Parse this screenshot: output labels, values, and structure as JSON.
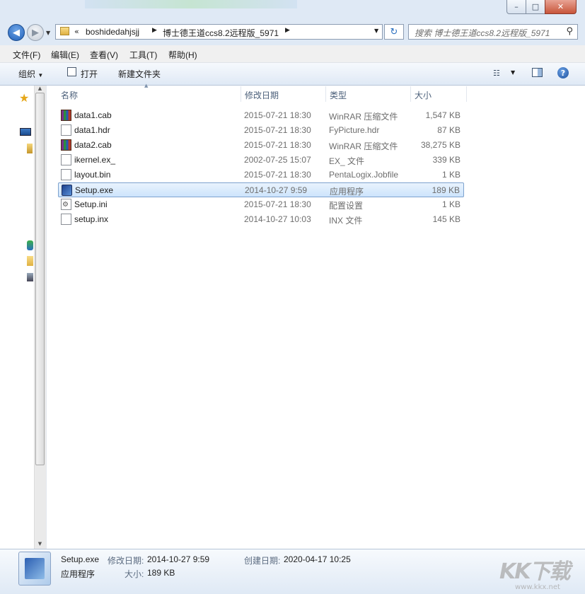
{
  "window": {
    "minimize_glyph": "–",
    "maximize_glyph": "□",
    "close_glyph": "✕"
  },
  "nav": {
    "back_glyph": "◀",
    "forward_glyph": "▶",
    "overflow": "«",
    "breadcrumbs": [
      "boshidedahjsjj",
      "博士德王道ccs8.2远程版_5971"
    ],
    "refresh_glyph": "↻"
  },
  "search": {
    "placeholder": "搜索 博士德王道ccs8.2远程版_5971"
  },
  "menu": {
    "items": [
      "文件(F)",
      "编辑(E)",
      "查看(V)",
      "工具(T)",
      "帮助(H)"
    ]
  },
  "toolbar": {
    "organize_label": "组织",
    "open_label": "打开",
    "new_folder_label": "新建文件夹",
    "help_glyph": "?"
  },
  "columns": {
    "name": "名称",
    "date": "修改日期",
    "type": "类型",
    "size": "大小"
  },
  "files": [
    {
      "name": "data1.cab",
      "date": "2015-07-21 18:30",
      "type": "WinRAR 压缩文件",
      "size": "1,547 KB",
      "icon": "rar"
    },
    {
      "name": "data1.hdr",
      "date": "2015-07-21 18:30",
      "type": "FyPicture.hdr",
      "size": "87 KB",
      "icon": "file"
    },
    {
      "name": "data2.cab",
      "date": "2015-07-21 18:30",
      "type": "WinRAR 压缩文件",
      "size": "38,275 KB",
      "icon": "rar"
    },
    {
      "name": "ikernel.ex_",
      "date": "2002-07-25 15:07",
      "type": "EX_ 文件",
      "size": "339 KB",
      "icon": "file"
    },
    {
      "name": "layout.bin",
      "date": "2015-07-21 18:30",
      "type": "PentaLogix.Jobfile",
      "size": "1 KB",
      "icon": "file"
    },
    {
      "name": "Setup.exe",
      "date": "2014-10-27 9:59",
      "type": "应用程序",
      "size": "189 KB",
      "icon": "exe",
      "selected": true
    },
    {
      "name": "Setup.ini",
      "date": "2015-07-21 18:30",
      "type": "配置设置",
      "size": "1 KB",
      "icon": "ini"
    },
    {
      "name": "setup.inx",
      "date": "2014-10-27 10:03",
      "type": "INX 文件",
      "size": "145 KB",
      "icon": "file"
    }
  ],
  "details": {
    "name": "Setup.exe",
    "type": "应用程序",
    "modified_label": "修改日期:",
    "modified_value": "2014-10-27 9:59",
    "created_label": "创建日期:",
    "created_value": "2020-04-17 10:25",
    "size_label": "大小:",
    "size_value": "189 KB"
  },
  "watermark": {
    "text": "KK下载",
    "url": "www.kkx.net"
  }
}
